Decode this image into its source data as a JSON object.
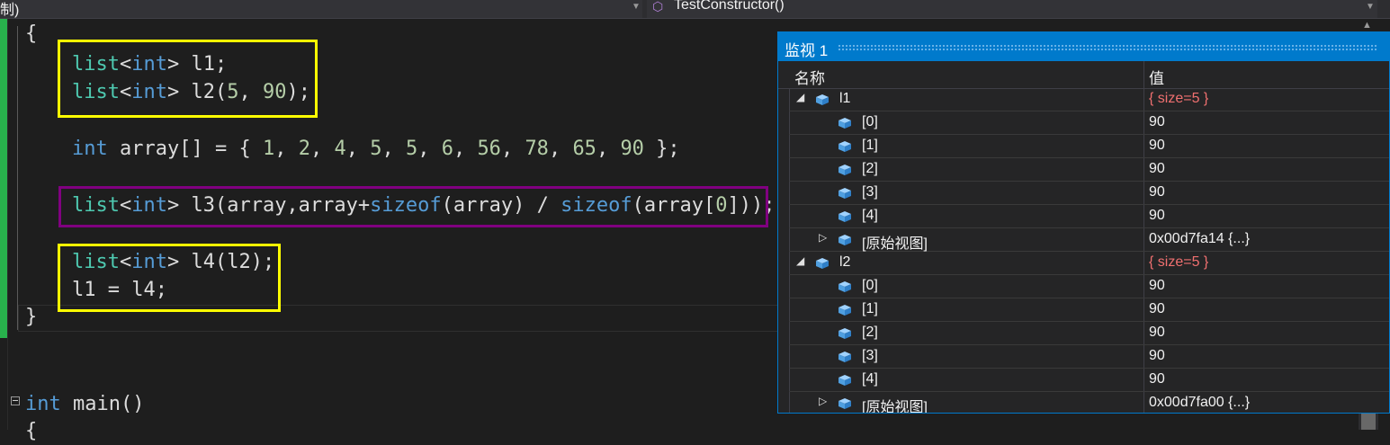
{
  "nav": {
    "left_text": "制)",
    "right_text": "TestConstructor()"
  },
  "code": {
    "open_brace": "{",
    "close_brace": "}",
    "main_open_brace": "{",
    "main_kw": "int",
    "main_rest": " main()"
  },
  "watch": {
    "title": "监视 1",
    "col_name": "名称",
    "col_value": "值",
    "rows": [
      {
        "name": "l1",
        "value": "{ size=5 }"
      },
      {
        "name": "[0]",
        "value": "90"
      },
      {
        "name": "[1]",
        "value": "90"
      },
      {
        "name": "[2]",
        "value": "90"
      },
      {
        "name": "[3]",
        "value": "90"
      },
      {
        "name": "[4]",
        "value": "90"
      },
      {
        "name": "[原始视图]",
        "value": "0x00d7fa14 {...}"
      },
      {
        "name": "l2",
        "value": "{ size=5 }"
      },
      {
        "name": "[0]",
        "value": "90"
      },
      {
        "name": "[1]",
        "value": "90"
      },
      {
        "name": "[2]",
        "value": "90"
      },
      {
        "name": "[3]",
        "value": "90"
      },
      {
        "name": "[4]",
        "value": "90"
      },
      {
        "name": "[原始视图]",
        "value": "0x00d7fa00 {...}"
      }
    ]
  },
  "colors": {
    "accent": "#007acc",
    "highlight_yellow": "#ffff00",
    "highlight_purple": "#800080",
    "changed_value": "#f07070"
  }
}
